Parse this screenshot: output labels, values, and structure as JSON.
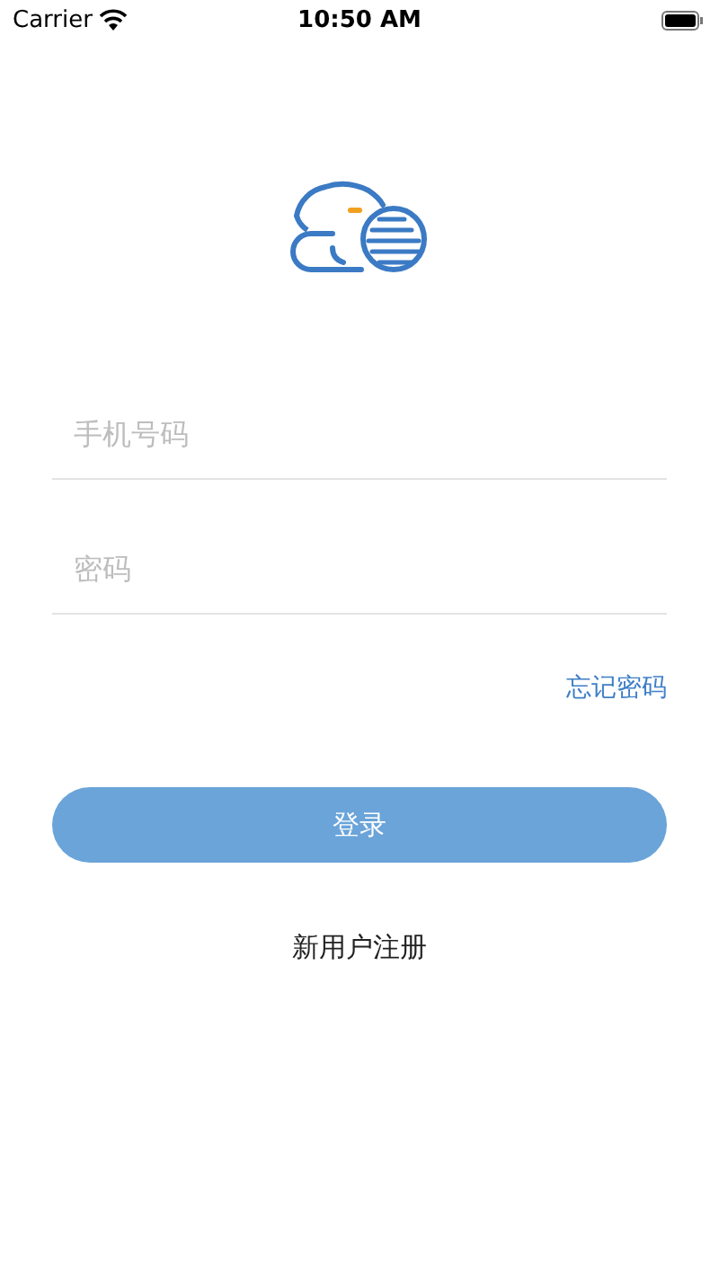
{
  "status_bar": {
    "carrier": "Carrier",
    "time": "10:50 AM"
  },
  "form": {
    "phone": {
      "placeholder": "手机号码"
    },
    "password": {
      "placeholder": "密码"
    },
    "forgot_link": "忘记密码",
    "login_button": "登录",
    "register_link": "新用户注册"
  }
}
